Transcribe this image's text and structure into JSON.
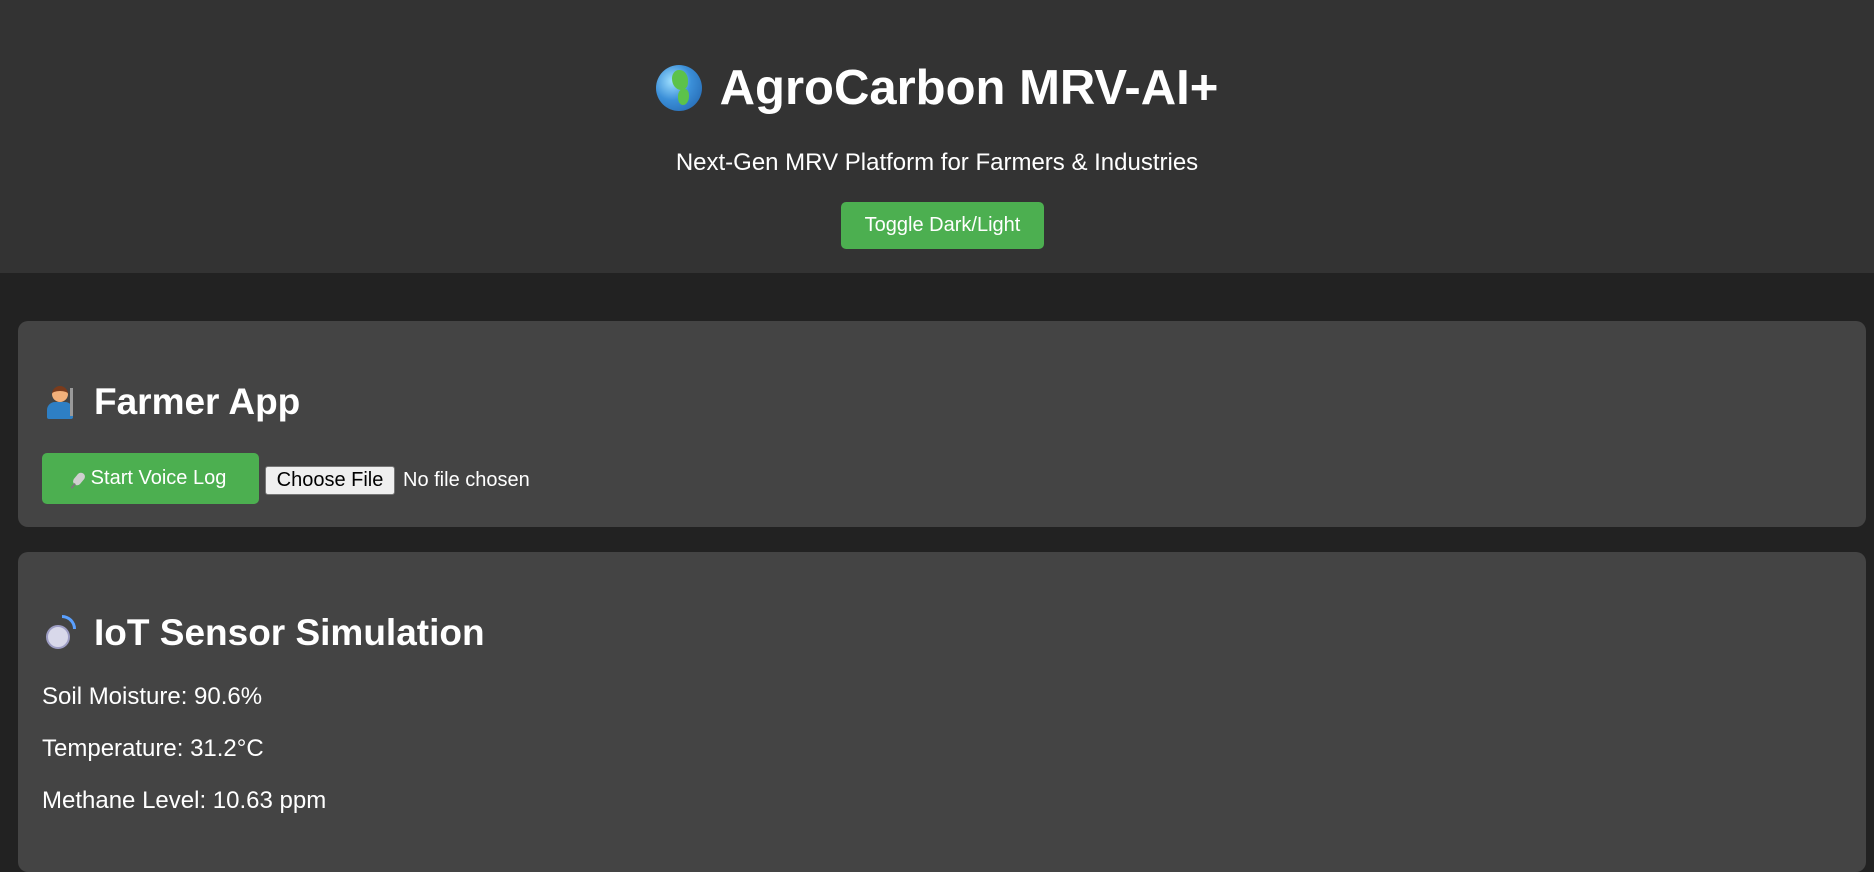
{
  "header": {
    "title": "AgroCarbon MRV-AI+",
    "title_icon": "globe-icon",
    "subtitle": "Next-Gen MRV Platform for Farmers & Industries",
    "toggle_label": "Toggle Dark/Light"
  },
  "farmer_app": {
    "title": "Farmer App",
    "title_icon": "farmer-icon",
    "voice_button_label": "Start Voice Log",
    "voice_button_icon": "microphone-icon",
    "file_button_label": "Choose File",
    "file_status": "No file chosen"
  },
  "iot_sensor": {
    "title": "IoT Sensor Simulation",
    "title_icon": "satellite-dish-icon",
    "readings": [
      "Soil Moisture: 90.6%",
      "Temperature: 31.2°C",
      "Methane Level: 10.63 ppm"
    ]
  },
  "colors": {
    "page_bg": "#222222",
    "header_bg": "#333333",
    "card_bg": "#444444",
    "accent_green": "#4caf50"
  }
}
